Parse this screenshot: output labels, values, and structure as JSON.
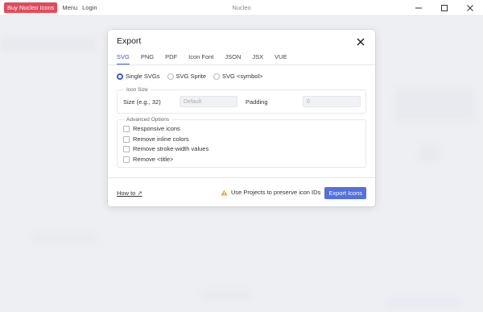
{
  "titlebar": {
    "buy_label": "Buy Nucleo Icons",
    "menu_label": "Menu",
    "login_label": "Login",
    "app_title": "Nucleo"
  },
  "dialog": {
    "title": "Export",
    "tabs": [
      {
        "label": "SVG",
        "active": true
      },
      {
        "label": "PNG"
      },
      {
        "label": "PDF"
      },
      {
        "label": "Icon Font"
      },
      {
        "label": "JSON"
      },
      {
        "label": "JSX"
      },
      {
        "label": "VUE"
      }
    ],
    "format_options": [
      {
        "label": "Single SVGs",
        "checked": true
      },
      {
        "label": "SVG Sprite"
      },
      {
        "label": "SVG <symbol>"
      }
    ],
    "icon_size": {
      "legend": "Icon Size",
      "size_label": "Size (e.g., 32)",
      "size_placeholder": "Default",
      "padding_label": "Padding",
      "padding_value": "0"
    },
    "advanced": {
      "legend": "Advanced Options",
      "options": [
        {
          "label": "Responsive icons"
        },
        {
          "label": "Remove inline colors"
        },
        {
          "label": "Remove stroke-width values"
        },
        {
          "label": "Remove <title>"
        }
      ]
    },
    "footer": {
      "howto_label": "How to ↗",
      "warning_text": "Use Projects to preserve icon IDs",
      "export_label": "Export Icons"
    }
  },
  "colors": {
    "accent": "#3b5bd8",
    "buy_button": "#e24b5b",
    "export_button": "#5470e0",
    "warning": "#f0a030"
  }
}
